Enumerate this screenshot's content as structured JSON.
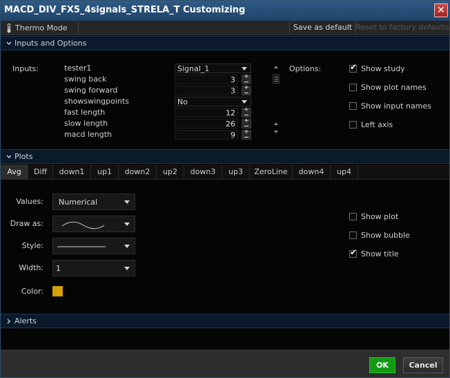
{
  "window": {
    "title": "MACD_DIV_FX5_4signals_STRELA_T Customizing",
    "close_icon": "close-icon"
  },
  "toolbar": {
    "thermo_label": "Thermo Mode",
    "thermo_icon": "thermometer-icon",
    "save_default": "Save as default",
    "reset_default": "Reset to factory defaults"
  },
  "inputs_section": {
    "header": "Inputs and Options",
    "inputs_label": "Inputs:",
    "params": [
      {
        "name": "tester1",
        "kind": "dropdown",
        "value": "Signal_1"
      },
      {
        "name": "swing back",
        "kind": "number",
        "value": "3"
      },
      {
        "name": "swing forward",
        "kind": "number",
        "value": "3"
      },
      {
        "name": "showswingpoints",
        "kind": "dropdown",
        "value": "No"
      },
      {
        "name": "fast length",
        "kind": "number",
        "value": "12"
      },
      {
        "name": "slow length",
        "kind": "number",
        "value": "26"
      },
      {
        "name": "macd length",
        "kind": "number",
        "value": "9"
      }
    ],
    "options_label": "Options:",
    "options": [
      {
        "label": "Show study",
        "checked": true
      },
      {
        "label": "Show plot names",
        "checked": false
      },
      {
        "label": "Show input names",
        "checked": false
      },
      {
        "label": "Left axis",
        "checked": false
      }
    ]
  },
  "plots_section": {
    "header": "Plots",
    "tabs": [
      "Avg",
      "Diff",
      "down1",
      "up1",
      "down2",
      "up2",
      "down3",
      "up3",
      "ZeroLine",
      "down4",
      "up4"
    ],
    "active_tab": "Avg",
    "values_label": "Values:",
    "values_value": "Numerical",
    "draw_as_label": "Draw as:",
    "style_label": "Style:",
    "width_label": "Width:",
    "width_value": "1",
    "color_label": "Color:",
    "color": "#d4a106",
    "plot_options": [
      {
        "label": "Show plot",
        "checked": false
      },
      {
        "label": "Show bubble",
        "checked": false
      },
      {
        "label": "Show title",
        "checked": true
      }
    ]
  },
  "alerts_section": {
    "header": "Alerts"
  },
  "footer": {
    "ok": "OK",
    "cancel": "Cancel"
  },
  "colors": {
    "accent_green": "#149a15",
    "title_blue": "#2f5a84",
    "close_red": "#c84a48"
  }
}
